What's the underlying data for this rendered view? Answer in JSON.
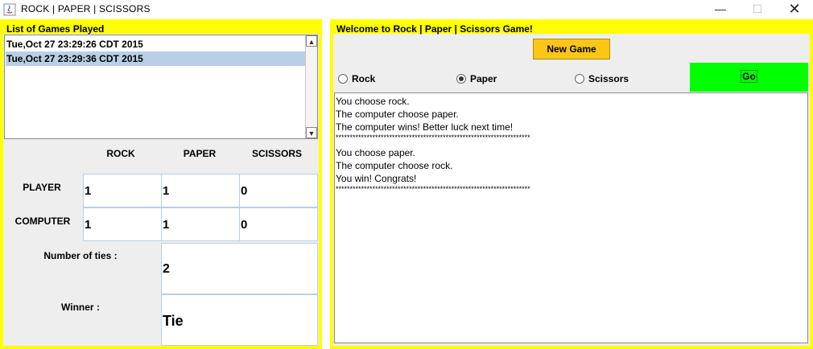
{
  "window": {
    "title": "ROCK | PAPER | SCISSORS",
    "minimize_glyph": "—",
    "maximize_glyph": "☐",
    "close_glyph": "✕"
  },
  "left": {
    "title": "List of Games Played",
    "games": [
      {
        "label": "Tue,Oct 27 23:29:26 CDT 2015",
        "selected": false
      },
      {
        "label": "Tue,Oct 27 23:29:36 CDT 2015",
        "selected": true
      }
    ],
    "columns": [
      "ROCK",
      "PAPER",
      "SCISSORS"
    ],
    "rows": [
      {
        "label": "PLAYER",
        "values": [
          "1",
          "1",
          "0"
        ]
      },
      {
        "label": "COMPUTER",
        "values": [
          "1",
          "1",
          "0"
        ]
      }
    ],
    "ties_label": "Number of ties :",
    "ties_value": "2",
    "winner_label": "Winner :",
    "winner_value": "Tie"
  },
  "right": {
    "title": "Welcome to Rock | Paper | Scissors Game!",
    "new_game_label": "New Game",
    "options": [
      {
        "label": "Rock",
        "checked": false
      },
      {
        "label": "Paper",
        "checked": true
      },
      {
        "label": "Scissors",
        "checked": false
      }
    ],
    "go_label": "Go",
    "output_lines": [
      "You choose rock.",
      "The computer choose paper.",
      "The computer wins! Better luck next time!",
      "*********************************************************************",
      "You choose paper.",
      "The computer choose rock.",
      "You win! Congrats!",
      "*********************************************************************"
    ]
  },
  "colors": {
    "panel_border": "#ffff00",
    "new_game_button": "#fbc617",
    "go_button": "#00ff00",
    "selection": "#b8cfe5"
  }
}
